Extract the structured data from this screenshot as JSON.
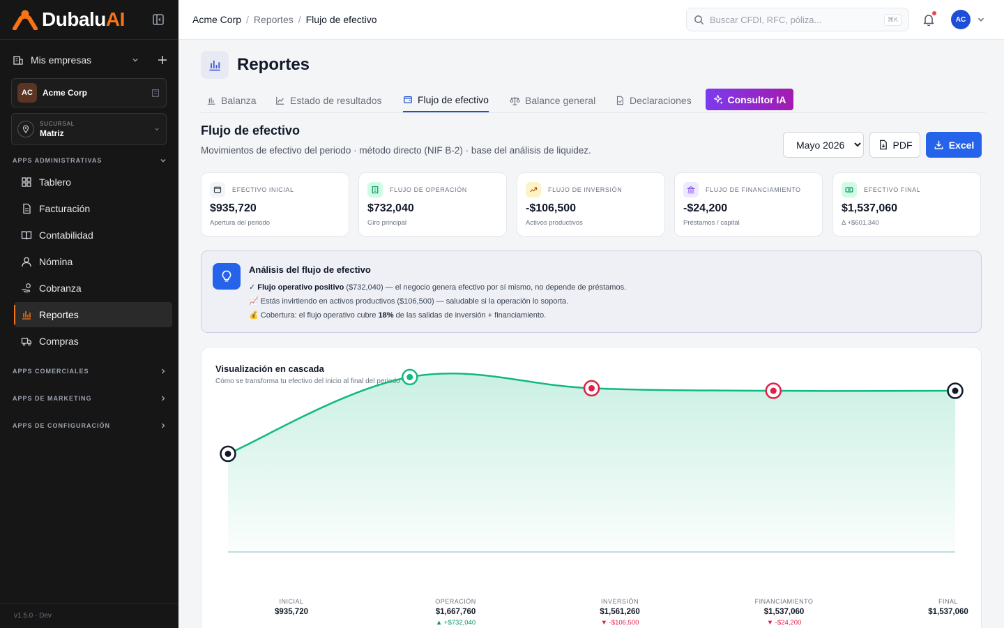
{
  "sidebar": {
    "brand": {
      "name": "Dubalu",
      "suffix": "AI",
      "accent": "#f97316"
    },
    "mis_empresas": "Mis empresas",
    "company": {
      "badge": "AC",
      "name": "Acme Corp"
    },
    "branch": {
      "caption": "SUCURSAL",
      "value": "Matriz"
    },
    "section_admin": "APPS ADMINISTRATIVAS",
    "items": [
      {
        "label": "Tablero",
        "icon": "grid-icon"
      },
      {
        "label": "Facturación",
        "icon": "invoice-icon"
      },
      {
        "label": "Contabilidad",
        "icon": "book-icon"
      },
      {
        "label": "Nómina",
        "icon": "user-icon"
      },
      {
        "label": "Cobranza",
        "icon": "hand-coins-icon"
      },
      {
        "label": "Reportes",
        "icon": "bar-chart-icon"
      },
      {
        "label": "Compras",
        "icon": "truck-icon"
      }
    ],
    "section_comerciales": "APPS COMERCIALES",
    "section_marketing": "APPS DE MARKETING",
    "section_config": "APPS DE CONFIGURACIÓN",
    "version": "v1.5.0 · Dev"
  },
  "topbar": {
    "breadcrumb": [
      "Acme Corp",
      "Reportes",
      "Flujo de efectivo"
    ],
    "search_placeholder": "Buscar CFDI, RFC, póliza...",
    "search_shortcut": "⌘K",
    "avatar": "AC"
  },
  "page": {
    "title": "Reportes",
    "tabs": [
      "Balanza",
      "Estado de resultados",
      "Flujo de efectivo",
      "Balance general",
      "Declaraciones"
    ],
    "ia_button": "Consultor IA",
    "section_title": "Flujo de efectivo",
    "section_subtitle": "Movimientos de efectivo del periodo · método directo (NIF B-2) · base del análisis de liquidez.",
    "period": "Mayo 2026",
    "pdf_label": "PDF",
    "excel_label": "Excel"
  },
  "kpis": [
    {
      "label": "EFECTIVO INICIAL",
      "value": "$935,720",
      "foot": "Apertura del periodo"
    },
    {
      "label": "FLUJO DE OPERACIÓN",
      "value": "$732,040",
      "foot": "Giro principal"
    },
    {
      "label": "FLUJO DE INVERSIÓN",
      "value": "-$106,500",
      "foot": "Activos productivos"
    },
    {
      "label": "FLUJO DE FINANCIAMIENTO",
      "value": "-$24,200",
      "foot": "Préstamos / capital"
    },
    {
      "label": "EFECTIVO FINAL",
      "value": "$1,537,060",
      "foot": "Δ +$601,340"
    }
  ],
  "analysis": {
    "title": "Análisis del flujo de efectivo",
    "line1_prefix": "✓ ",
    "line1_bold": "Flujo operativo positivo",
    "line1_rest": " ($732,040) — el negocio genera efectivo por sí mismo, no depende de préstamos.",
    "line2": "📈 Estás invirtiendo en activos productivos ($106,500) — saludable si la operación lo soporta.",
    "line3_prefix": "💰 Cobertura: el flujo operativo cubre ",
    "line3_bold": "18%",
    "line3_rest": " de las salidas de inversión + financiamiento."
  },
  "chart_data": {
    "type": "area",
    "title": "Visualización en cascada",
    "subtitle": "Cómo se transforma tu efectivo del inicio al final del periodo",
    "categories": [
      "INICIAL",
      "OPERACIÓN",
      "INVERSIÓN",
      "FINANCIAMIENTO",
      "FINAL"
    ],
    "values": [
      935720,
      1667760,
      1561260,
      1537060,
      1537060
    ],
    "value_labels": [
      "$935,720",
      "$1,667,760",
      "$1,561,260",
      "$1,537,060",
      "$1,537,060"
    ],
    "deltas": [
      "",
      "▲ +$732,040",
      "▼ -$106,500",
      "▼ -$24,200",
      ""
    ],
    "point_colors": [
      "#111827",
      "#10b981",
      "#e11d48",
      "#e11d48",
      "#111827"
    ],
    "line_color": "#10b981",
    "ylim": [
      0,
      1950000
    ]
  }
}
